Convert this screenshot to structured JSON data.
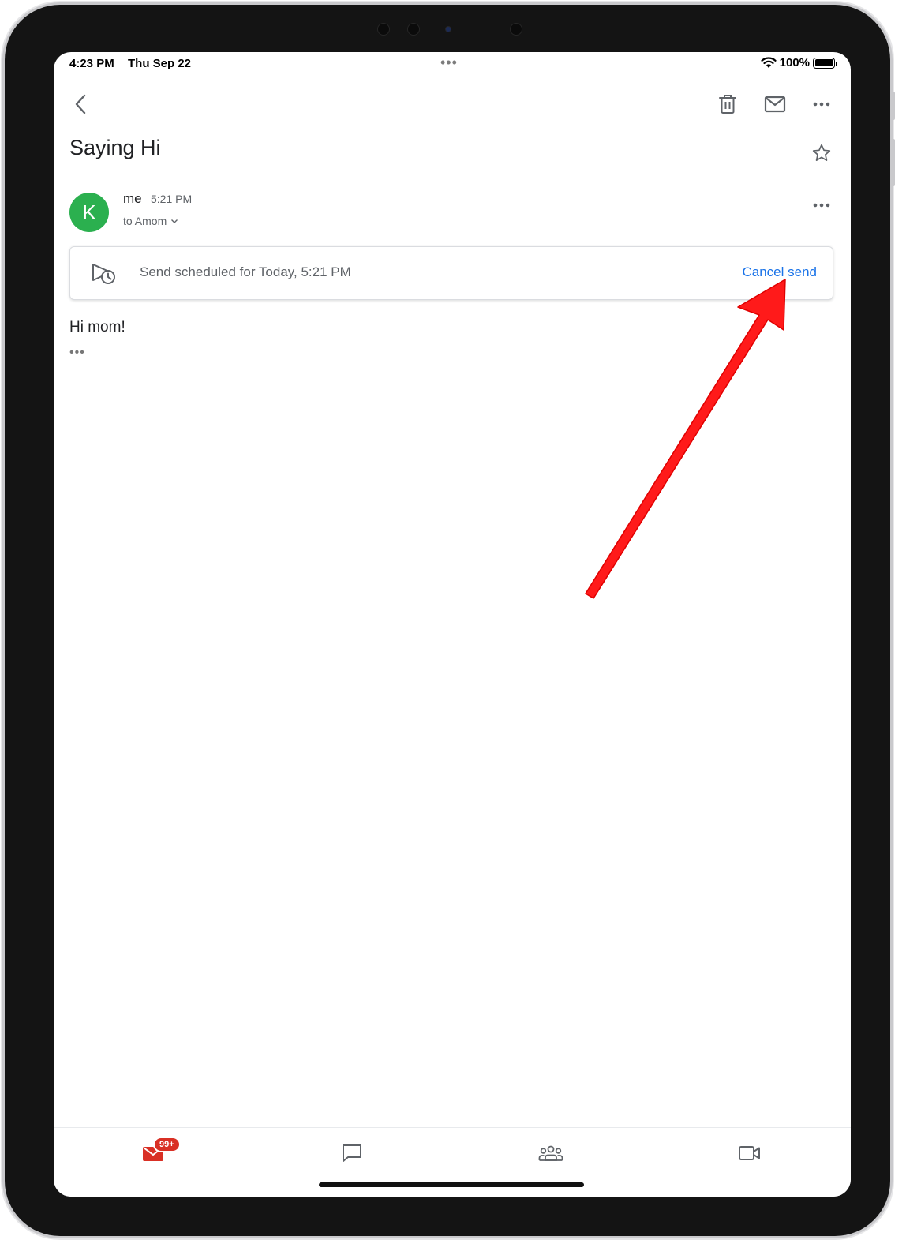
{
  "status_bar": {
    "time": "4:23 PM",
    "date": "Thu Sep 22",
    "battery": "100%"
  },
  "toolbar": {
    "icons": [
      "back-icon",
      "trash-icon",
      "mail-icon",
      "more-icon"
    ]
  },
  "email": {
    "subject": "Saying Hi",
    "sender_initial": "K",
    "sender_name": "me",
    "sent_time": "5:21 PM",
    "recipient": "to Amom",
    "scheduled_notice": "Send scheduled for Today, 5:21 PM",
    "cancel_label": "Cancel send",
    "body": "Hi mom!",
    "more_content": "•••"
  },
  "bottom_nav": {
    "mail_badge": "99+",
    "tabs": [
      "mail-icon",
      "chat-icon",
      "spaces-icon",
      "meet-icon"
    ]
  },
  "colors": {
    "avatar": "#2bb04f",
    "link": "#1a73e8",
    "badge": "#d93025",
    "annotation_arrow": "#ff1a1a"
  }
}
